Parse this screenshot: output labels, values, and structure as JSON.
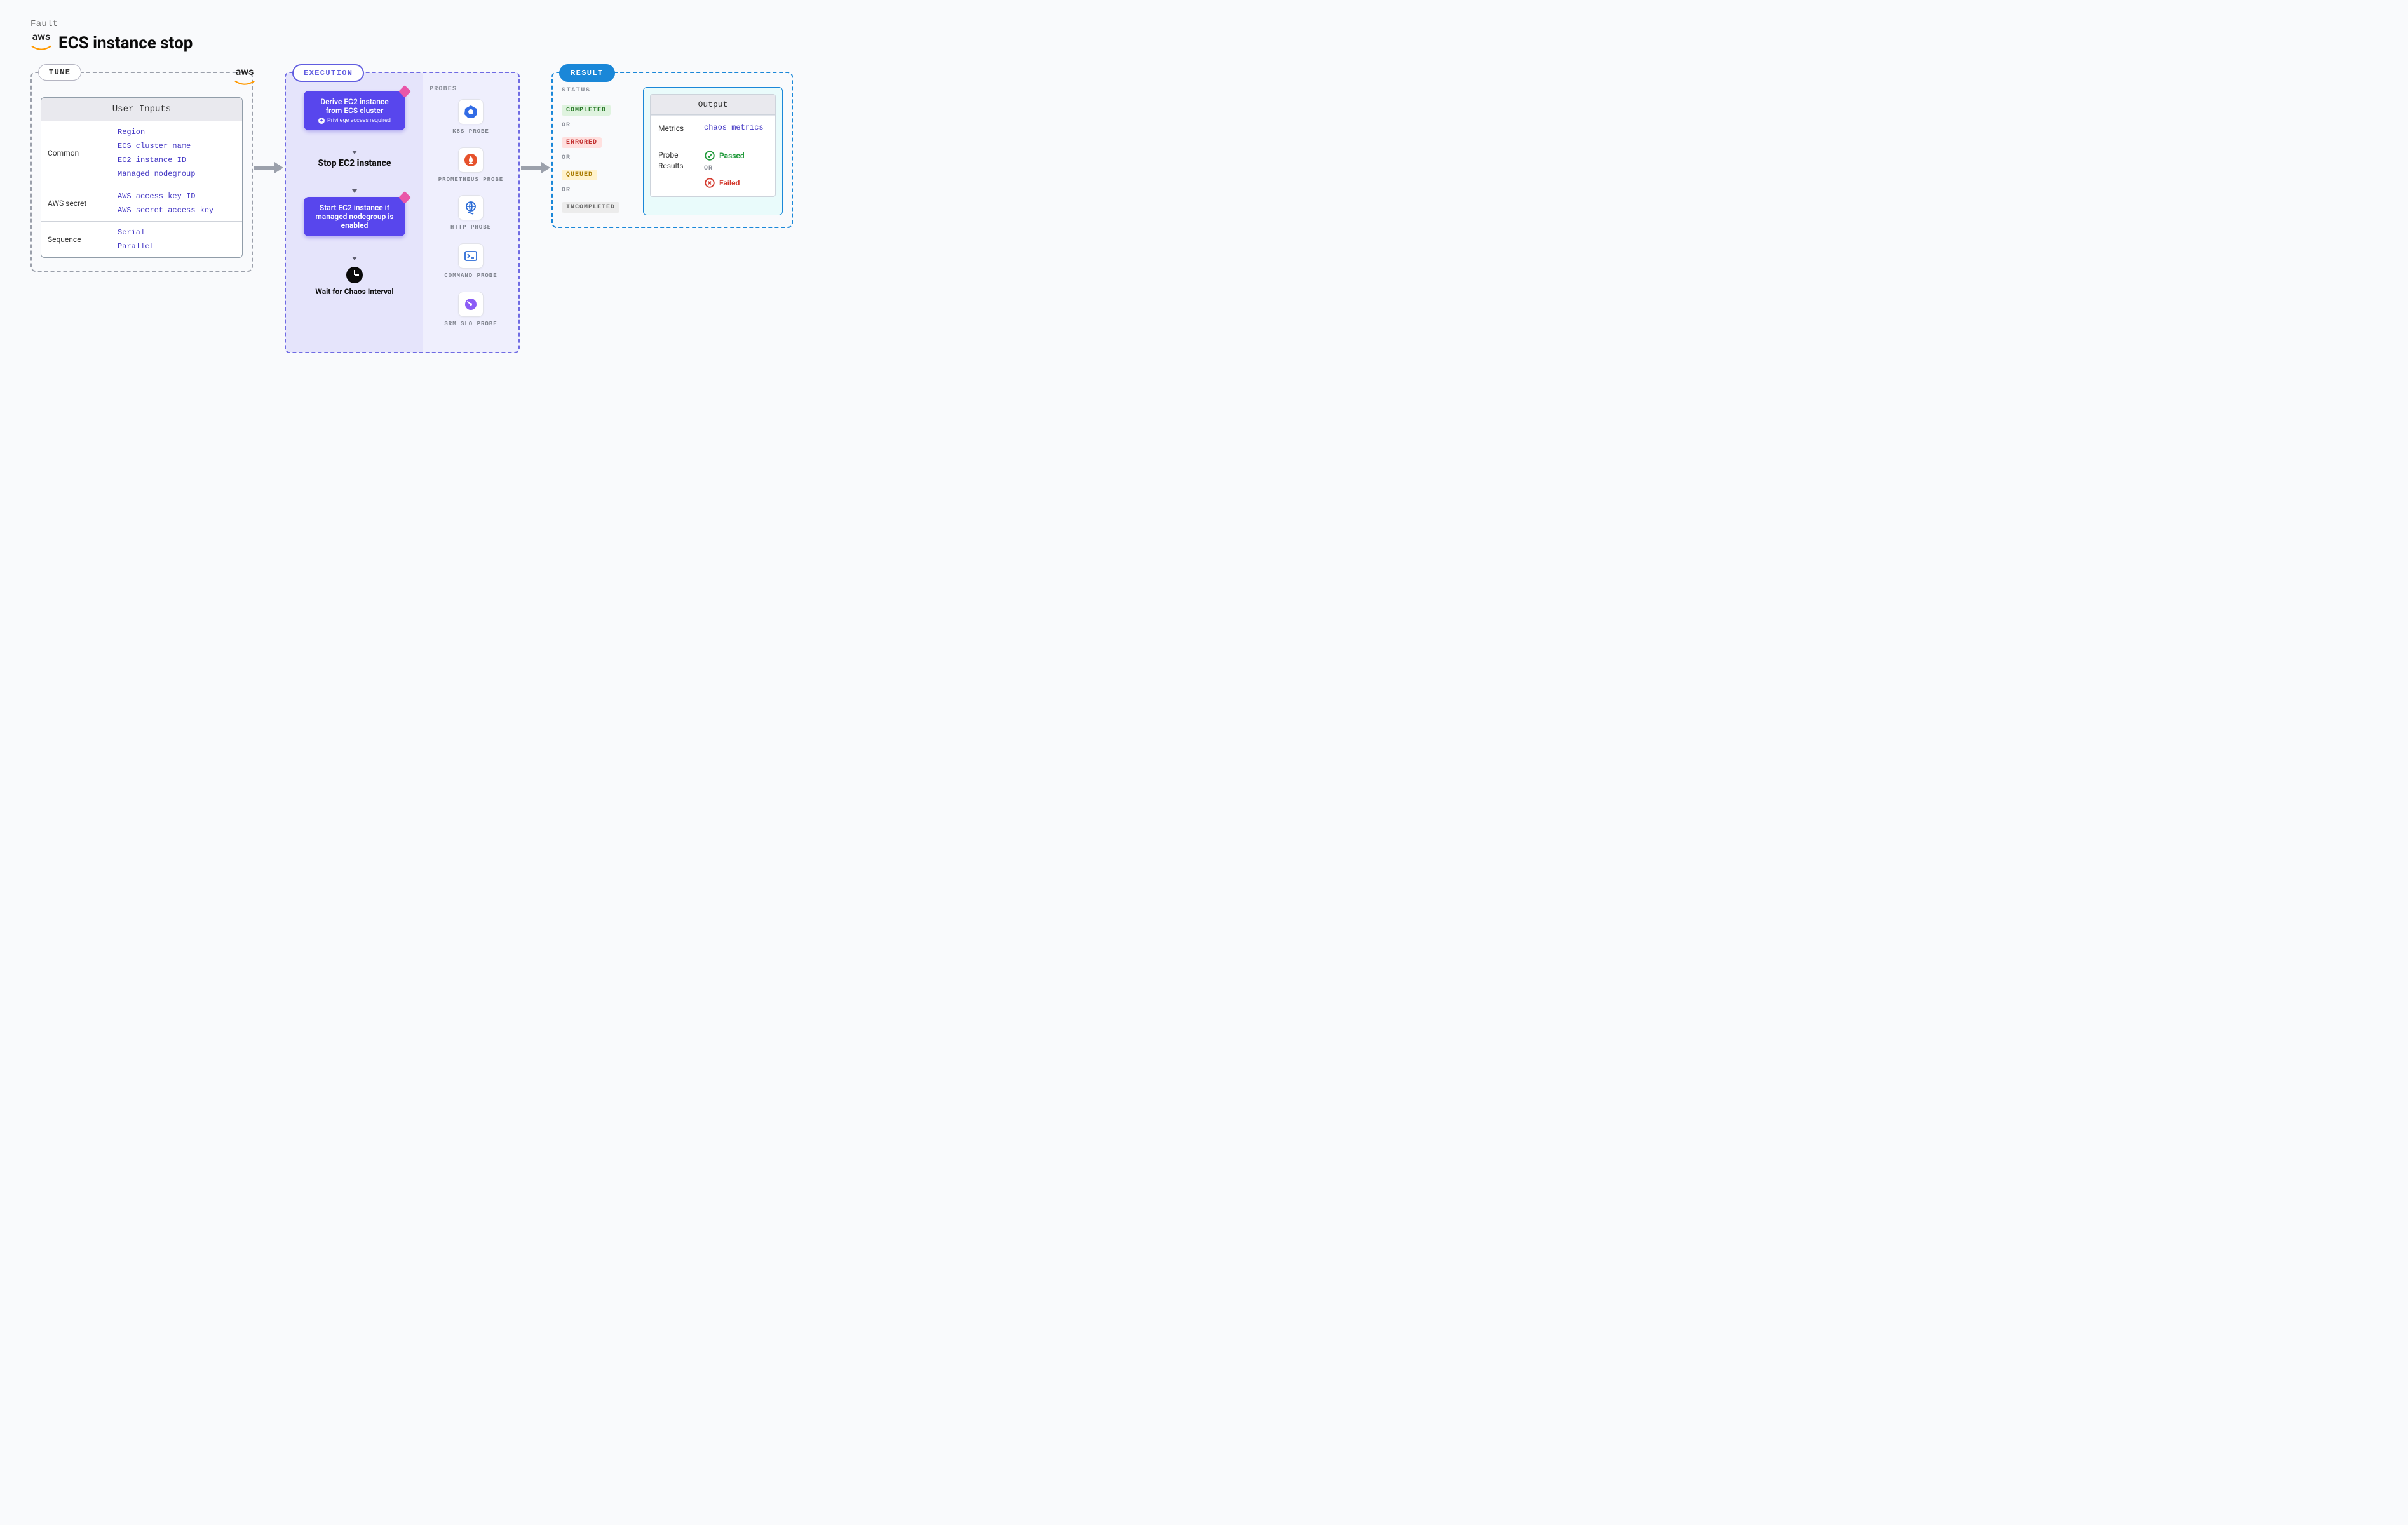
{
  "header": {
    "eyebrow": "Fault",
    "title": "ECS instance stop",
    "aws_label": "aws"
  },
  "tune": {
    "chip": "TUNE",
    "aws_label": "aws",
    "card_title": "User Inputs",
    "groups": [
      {
        "label": "Common",
        "items": [
          "Region",
          "ECS cluster name",
          "EC2 instance ID",
          "Managed nodegroup"
        ]
      },
      {
        "label": "AWS secret",
        "items": [
          "AWS access key ID",
          "AWS secret access key"
        ]
      },
      {
        "label": "Sequence",
        "items": [
          "Serial",
          "Parallel"
        ]
      }
    ]
  },
  "execution": {
    "chip": "EXECUTION",
    "step1": "Derive EC2 instance from ECS cluster",
    "priv": "Privilege access required",
    "step2": "Stop EC2 instance",
    "step3": "Start EC2 instance if managed nodegroup is enabled",
    "wait": "Wait for Chaos Interval",
    "probes_header": "PROBES",
    "probes": [
      "K8S PROBE",
      "PROMETHEUS PROBE",
      "HTTP PROBE",
      "COMMAND PROBE",
      "SRM SLO PROBE"
    ]
  },
  "result": {
    "chip": "RESULT",
    "status_header": "STATUS",
    "statuses": [
      "COMPLETED",
      "ERRORED",
      "QUEUED",
      "INCOMPLETED"
    ],
    "or": "OR",
    "output": {
      "title": "Output",
      "metrics_k": "Metrics",
      "metrics_v": "chaos metrics",
      "probe_k": "Probe Results",
      "passed": "Passed",
      "failed": "Failed"
    }
  }
}
